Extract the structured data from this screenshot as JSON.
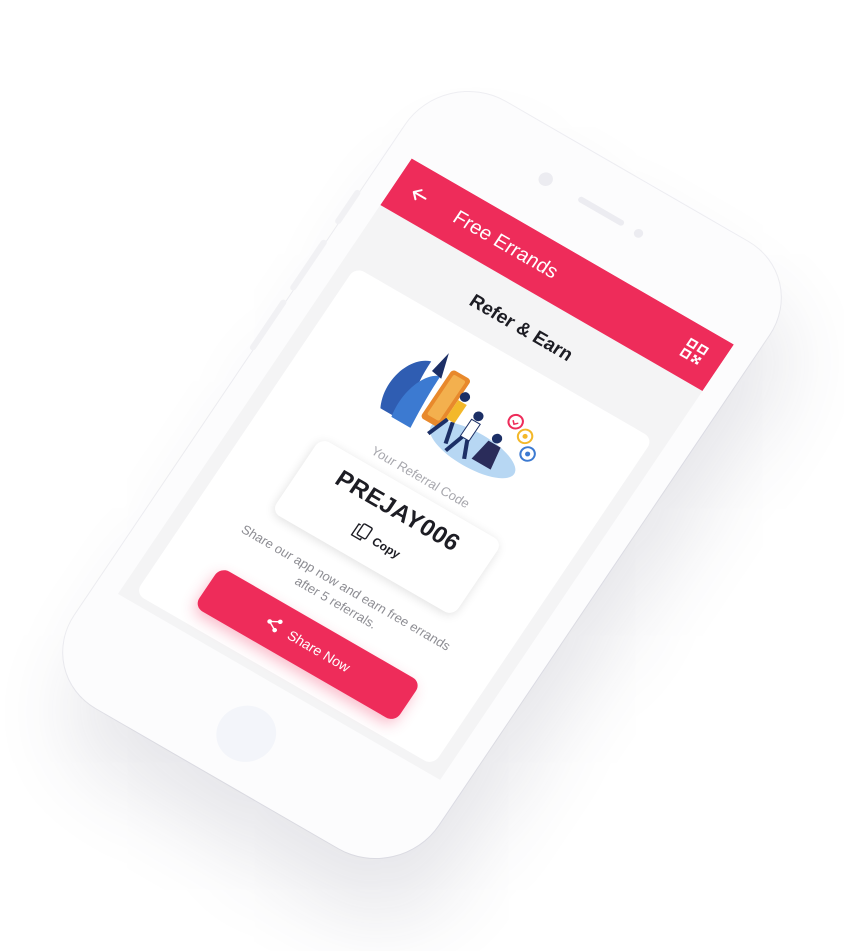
{
  "appbar": {
    "title": "Free Errands",
    "back_icon": "arrow-left-icon",
    "qr_icon": "qr-code-icon"
  },
  "page": {
    "title": "Refer & Earn"
  },
  "referral": {
    "label": "Your Referral Code",
    "code": "PREJAY006",
    "copy_label": "Copy",
    "copy_icon": "copy-icon"
  },
  "share": {
    "text": "Share our app now and earn free errands after 5 referrals.",
    "button_label": "Share Now",
    "icon": "share-icon"
  },
  "colors": {
    "accent": "#ee2c5a",
    "background": "#f4f4f5",
    "card": "#ffffff",
    "text_dark": "#1d1d24",
    "text_muted": "#a7a7ad"
  }
}
